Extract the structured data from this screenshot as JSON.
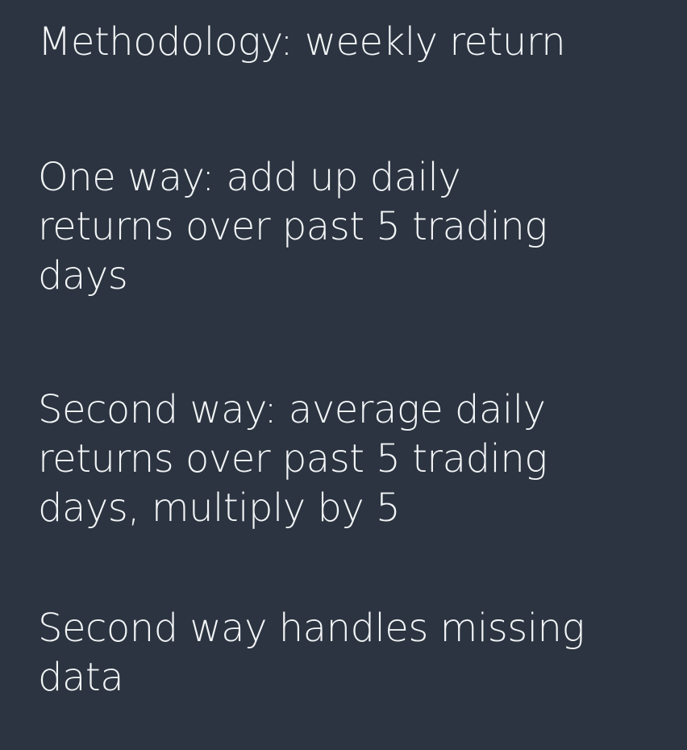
{
  "slide": {
    "background_color": "#2b3440",
    "text_color": "#f2f4f6",
    "paragraphs": [
      "Methodology: weekly return",
      "One way: add up daily\nreturns over past 5 trading\ndays",
      "Second way: average daily\nreturns over past 5 trading\ndays, multiply by 5",
      "Second way handles missing\ndata"
    ]
  }
}
